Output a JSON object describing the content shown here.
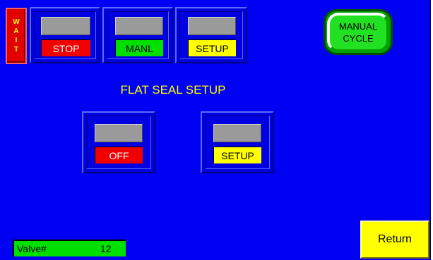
{
  "status": {
    "wait_letters": [
      "W",
      "A",
      "I",
      "T"
    ]
  },
  "top_buttons": {
    "stop_label": "STOP",
    "manl_label": "MANL",
    "setup_label": "SETUP"
  },
  "manual_cycle": {
    "line1": "MANUAL",
    "line2": "CYCLE"
  },
  "screen_title": "FLAT SEAL SETUP",
  "center_buttons": {
    "off_label": "OFF",
    "setup_label": "SETUP"
  },
  "valve": {
    "label": "Valve#",
    "value": "12"
  },
  "return_label": "Return",
  "colors": {
    "background": "#0000f2",
    "lamp_off": "#9a9a9a",
    "red": "#f00000",
    "green": "#00e000",
    "yellow": "#ffff00"
  }
}
